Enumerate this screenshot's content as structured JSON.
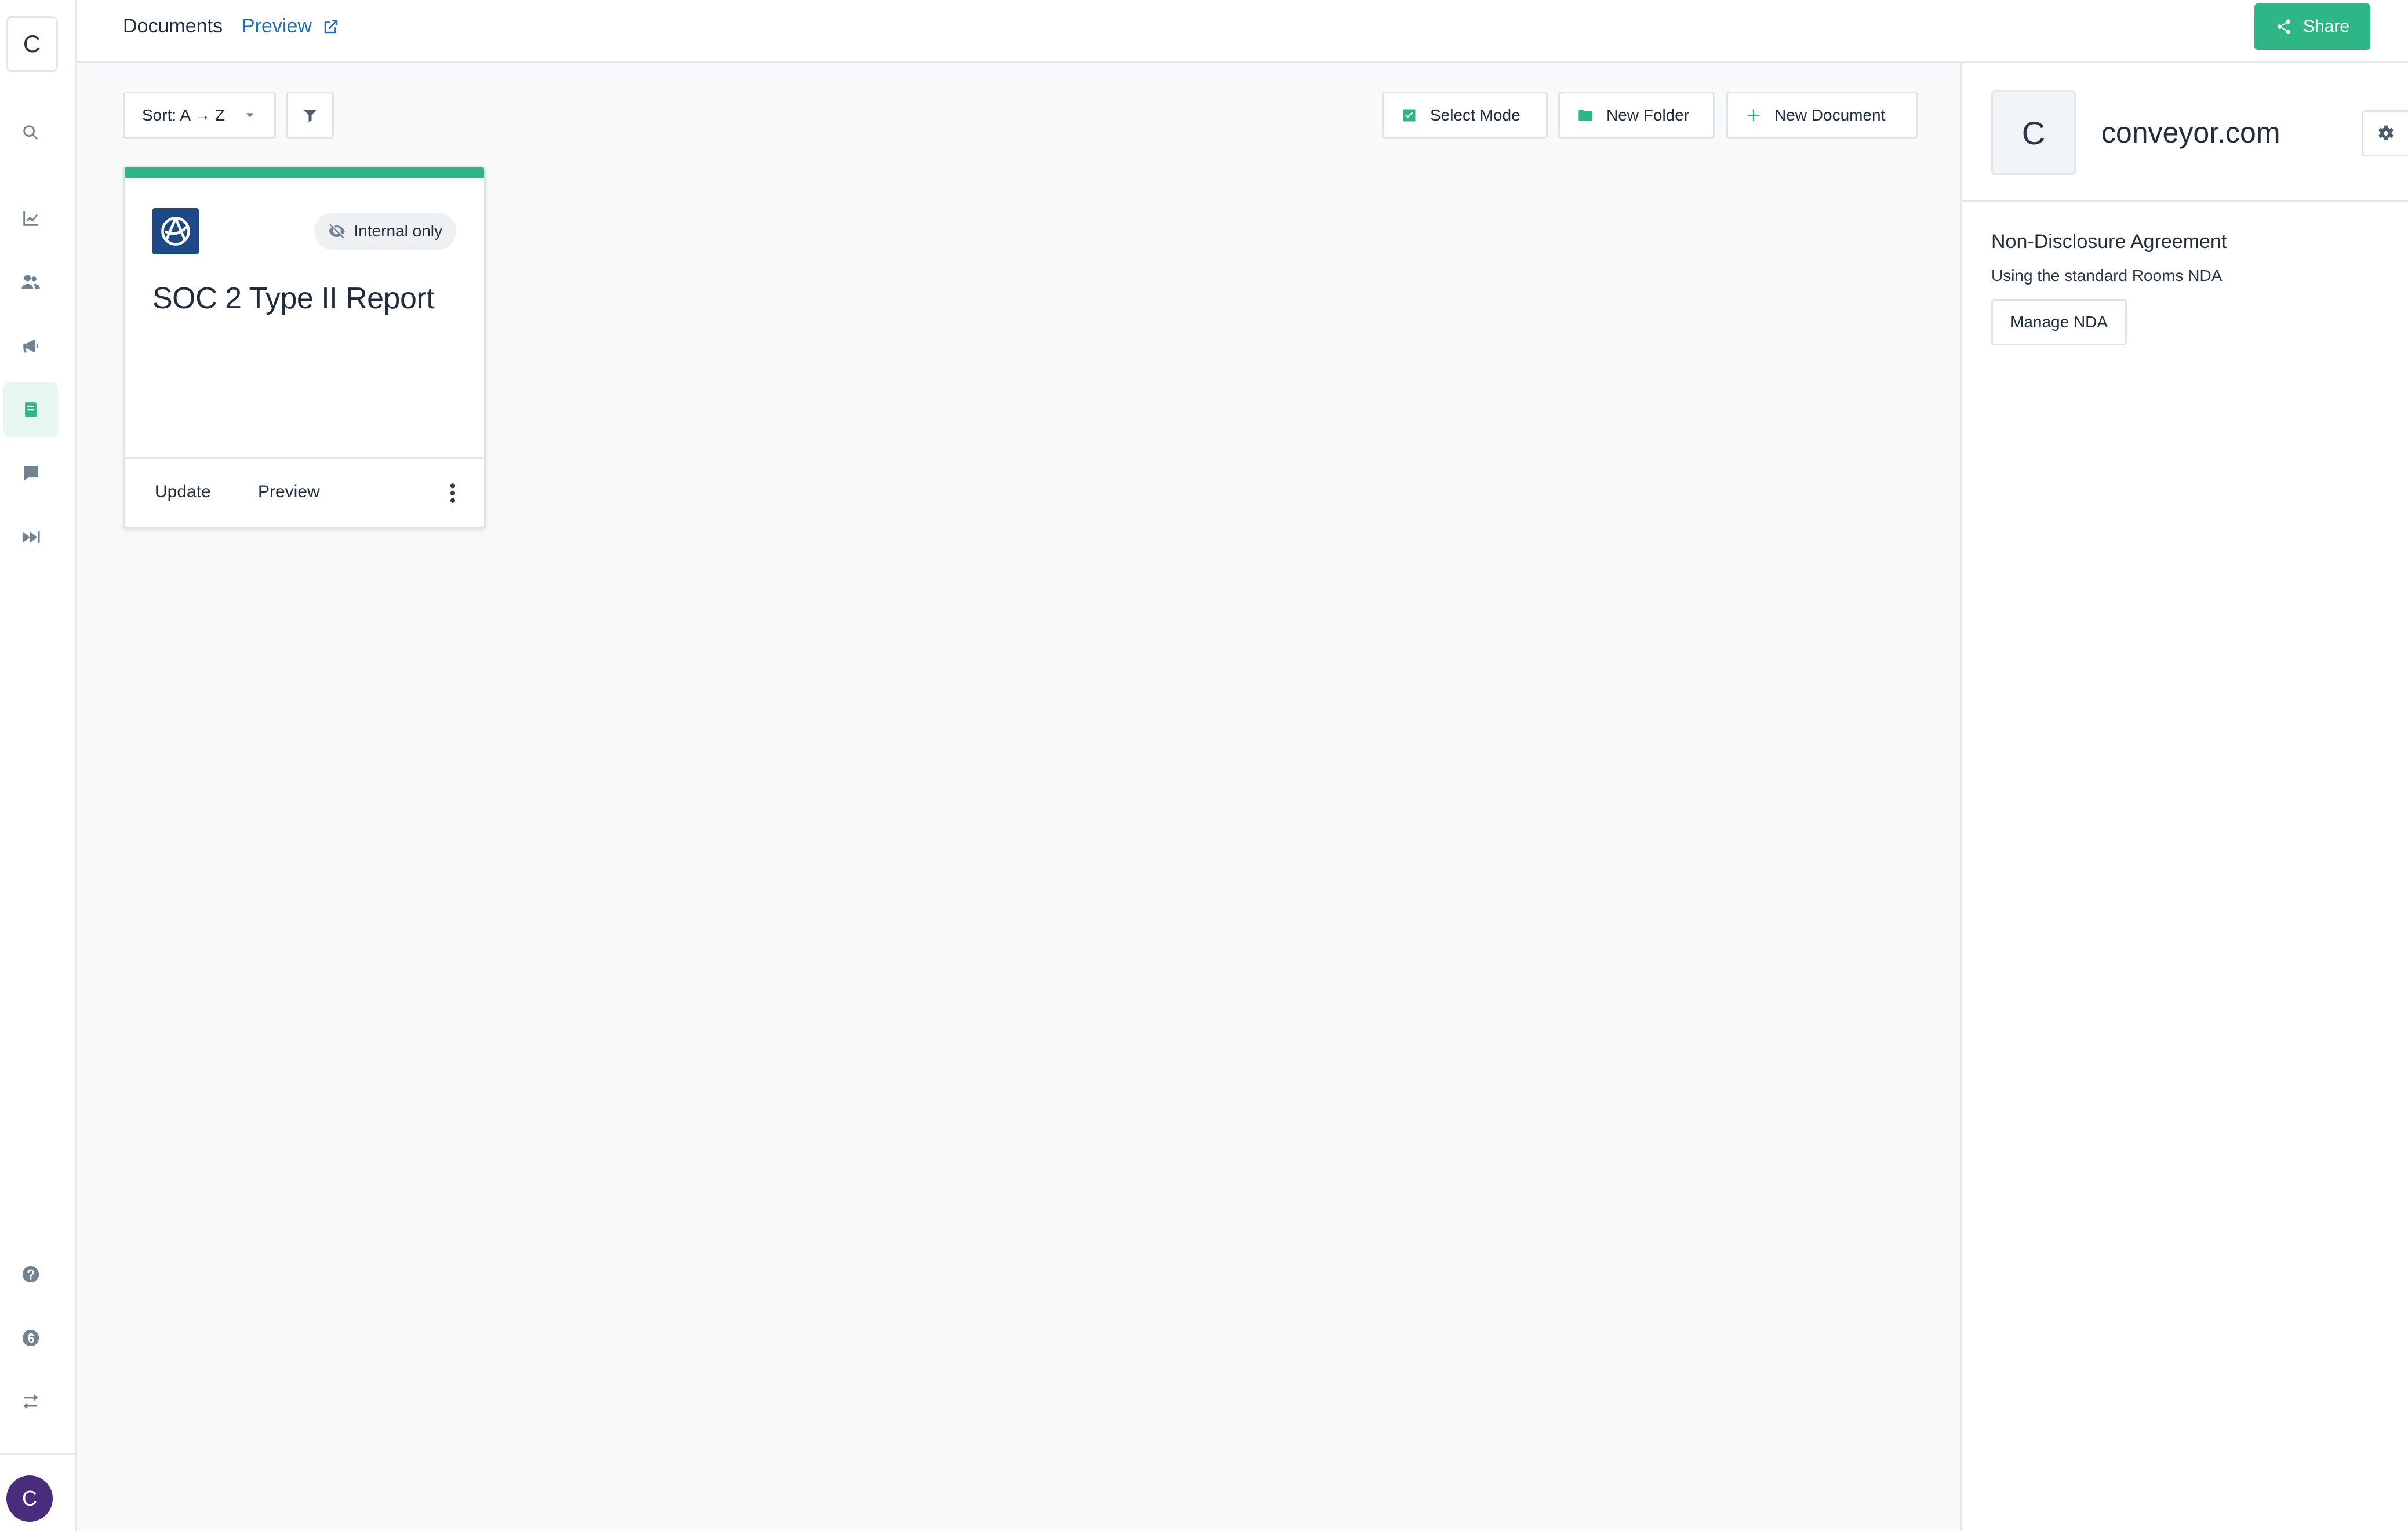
{
  "nav": {
    "logo_letter": "C",
    "avatar_letter": "C",
    "items": [
      {
        "icon": "search-icon"
      },
      {
        "icon": "chart-icon"
      },
      {
        "icon": "users-icon"
      },
      {
        "icon": "megaphone-icon"
      },
      {
        "icon": "document-icon",
        "active": true
      },
      {
        "icon": "chat-icon"
      },
      {
        "icon": "fast-forward-icon"
      },
      {
        "icon": "help-icon"
      },
      {
        "icon": "number-badge-icon"
      },
      {
        "icon": "swap-icon"
      }
    ]
  },
  "header": {
    "title": "Documents",
    "preview_link": "Preview",
    "share_label": "Share"
  },
  "toolbar": {
    "sort_label": "Sort: A → Z",
    "select_mode_label": "Select Mode",
    "new_folder_label": "New Folder",
    "new_document_label": "New Document"
  },
  "documents": [
    {
      "title": "SOC 2 Type II Report",
      "badge": "Internal only",
      "update_label": "Update",
      "preview_label": "Preview"
    }
  ],
  "panel": {
    "org_letter": "C",
    "org_name": "conveyor.com",
    "nda_title": "Non-Disclosure Agreement",
    "nda_subtitle": "Using the standard Rooms NDA",
    "manage_nda_label": "Manage NDA"
  },
  "colors": {
    "accent": "#2fb686",
    "link": "#1f6fb5",
    "avatar": "#4a2c7c",
    "doc_logo": "#1d4a86"
  }
}
